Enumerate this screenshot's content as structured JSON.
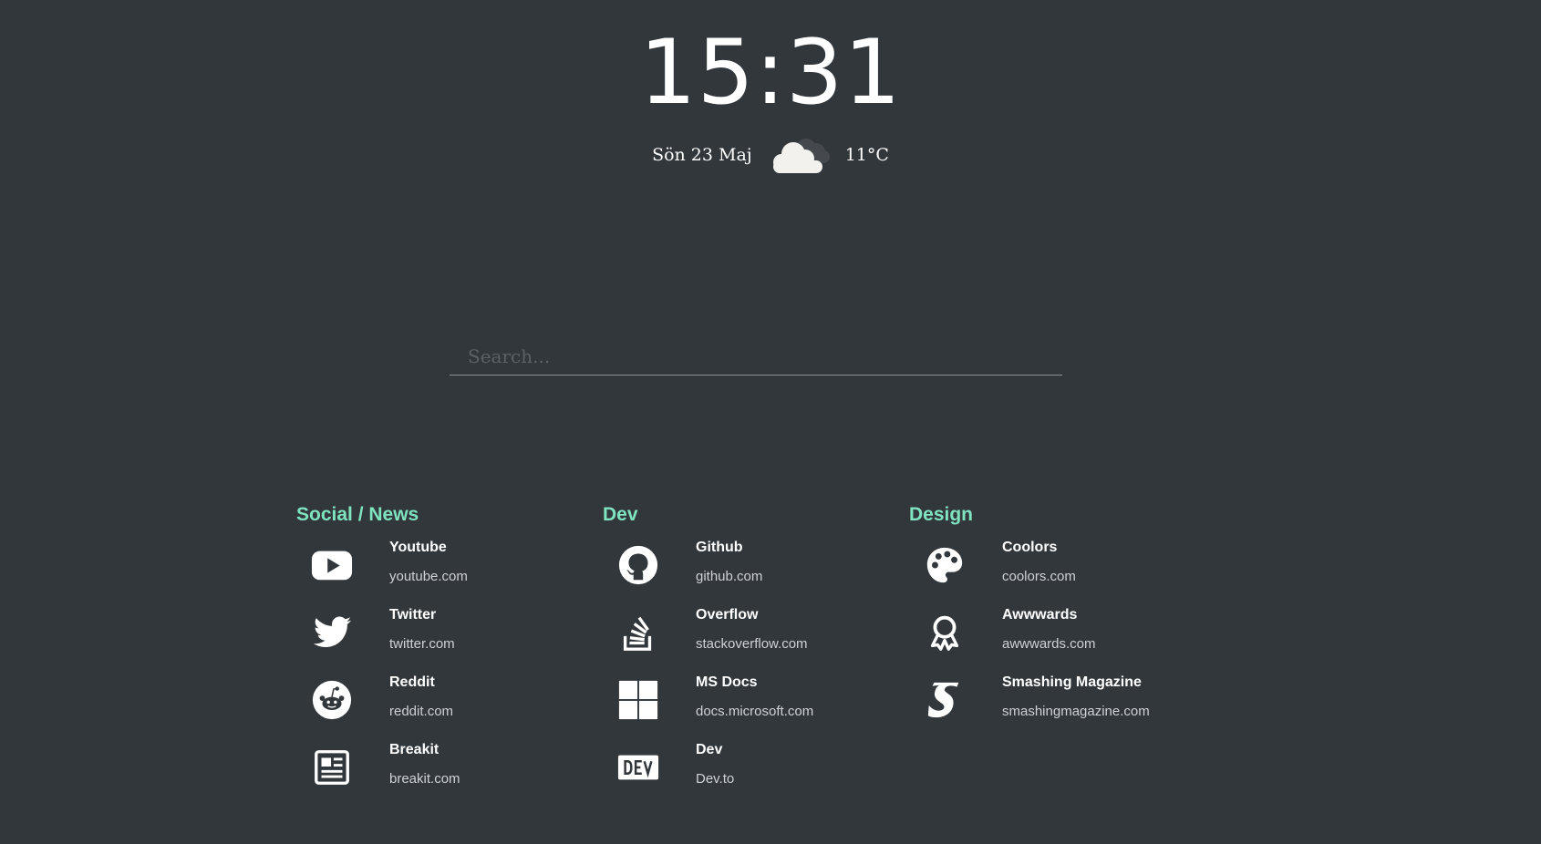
{
  "clock": {
    "time": "15:31"
  },
  "info": {
    "date": "Sön 23 Maj",
    "weather_icon": "cloud-icon",
    "temperature": "11°C"
  },
  "search": {
    "placeholder": "Search..."
  },
  "colors": {
    "background": "#32373b",
    "accent": "#7fe3c0",
    "text": "#ffffff",
    "muted": "#cfd2d4"
  },
  "categories": [
    {
      "title": "Social / News",
      "links": [
        {
          "name": "Youtube",
          "url": "youtube.com",
          "icon": "youtube-icon"
        },
        {
          "name": "Twitter",
          "url": "twitter.com",
          "icon": "twitter-icon"
        },
        {
          "name": "Reddit",
          "url": "reddit.com",
          "icon": "reddit-icon"
        },
        {
          "name": "Breakit",
          "url": "breakit.com",
          "icon": "newspaper-icon"
        }
      ]
    },
    {
      "title": "Dev",
      "links": [
        {
          "name": "Github",
          "url": "github.com",
          "icon": "github-icon"
        },
        {
          "name": "Overflow",
          "url": "stackoverflow.com",
          "icon": "stackoverflow-icon"
        },
        {
          "name": "MS Docs",
          "url": "docs.microsoft.com",
          "icon": "windows-icon"
        },
        {
          "name": "Dev",
          "url": "Dev.to",
          "icon": "dev-icon"
        }
      ]
    },
    {
      "title": "Design",
      "links": [
        {
          "name": "Coolors",
          "url": "coolors.com",
          "icon": "palette-icon"
        },
        {
          "name": "Awwwards",
          "url": "awwwards.com",
          "icon": "award-icon"
        },
        {
          "name": "Smashing Magazine",
          "url": "smashingmagazine.com",
          "icon": "smashing-icon"
        }
      ]
    }
  ]
}
